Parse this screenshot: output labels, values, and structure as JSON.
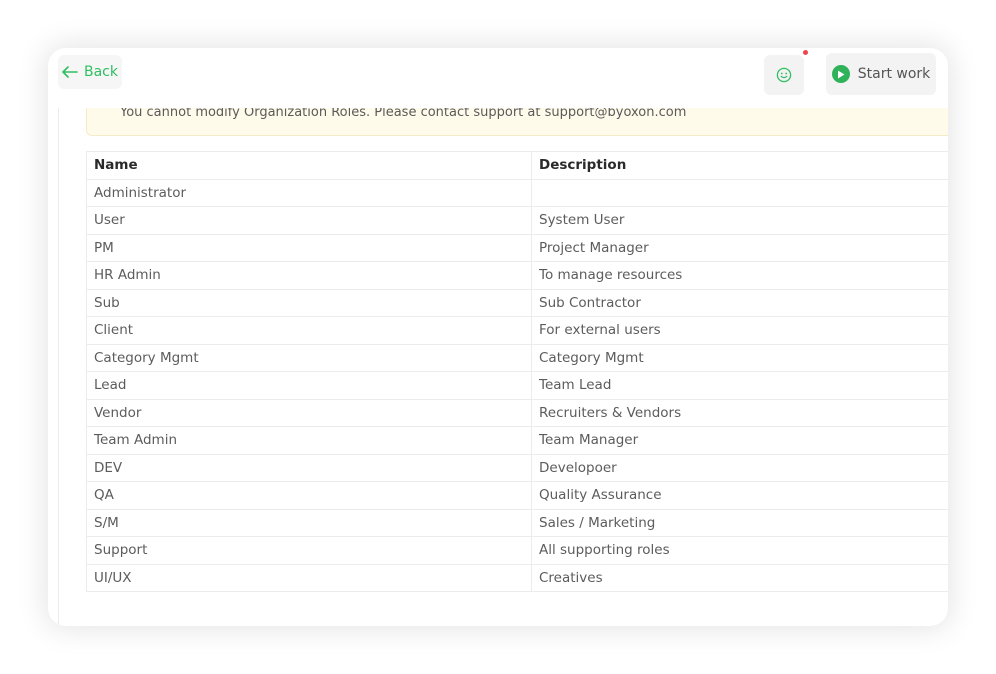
{
  "header": {
    "back_label": "Back",
    "start_label": "Start work"
  },
  "notice": {
    "text": "You cannot modify Organization Roles. Please contact support at support@byoxon.com"
  },
  "table": {
    "columns": [
      "Name",
      "Description"
    ],
    "rows": [
      [
        "Administrator",
        ""
      ],
      [
        "User",
        "System User"
      ],
      [
        "PM",
        "Project Manager"
      ],
      [
        "HR Admin",
        "To manage resources"
      ],
      [
        "Sub",
        "Sub Contractor"
      ],
      [
        "Client",
        "For external users"
      ],
      [
        "Category Mgmt",
        "Category Mgmt"
      ],
      [
        "Lead",
        "Team Lead"
      ],
      [
        "Vendor",
        "Recruiters & Vendors"
      ],
      [
        "Team Admin",
        "Team Manager"
      ],
      [
        "DEV",
        "Developoer"
      ],
      [
        "QA",
        "Quality Assurance"
      ],
      [
        "S/M",
        "Sales / Marketing"
      ],
      [
        "Support",
        "All supporting roles"
      ],
      [
        "UI/UX",
        "Creatives"
      ]
    ]
  },
  "colors": {
    "accent_green": "#2fbf61",
    "notice_bg": "#fffbeb",
    "notification_dot": "#f0444b"
  },
  "icons": {
    "back": "arrow-left-icon",
    "mood": "smile-icon",
    "start": "play-icon"
  }
}
